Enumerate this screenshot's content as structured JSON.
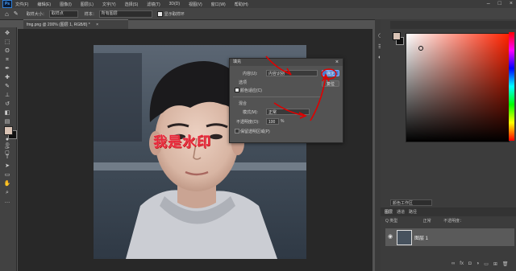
{
  "menu": [
    "文件(F)",
    "编辑(E)",
    "图像(I)",
    "图层(L)",
    "文字(Y)",
    "选择(S)",
    "滤镜(T)",
    "3D(D)",
    "视图(V)",
    "窗口(W)",
    "帮助(H)"
  ],
  "app_logo": "Ps",
  "options": {
    "sample_size_label": "取样大小：",
    "sample_size_value": "取样点",
    "sample_label": "样本：",
    "sample_value": "所有图层",
    "show_ring_label": "显示取样环"
  },
  "document": {
    "tab_title": "fmg.png @ 200% (图层 1, RGB/8) *",
    "close": "×"
  },
  "watermark_text": "我是水印",
  "fill_dialog": {
    "title": "填充",
    "content_label": "内容(U):",
    "content_value": "内容识别",
    "options_label": "选项",
    "color_adapt_label": "颜色适应(C)",
    "blend_label": "混合",
    "mode_label": "模式(M):",
    "mode_value": "正常",
    "opacity_label": "不透明度(O):",
    "opacity_value": "100",
    "opacity_unit": "%",
    "preserve_label": "保留透明区域(P)",
    "ok_label": "确定",
    "cancel_label": "复位"
  },
  "layers_panel": {
    "tabs": [
      "图层",
      "通道",
      "路径"
    ],
    "kind_label": "Q 类型",
    "blend_mode": "正常",
    "opacity_label": "不透明度：",
    "lock_label": "锁定：",
    "fill_label": "填充：",
    "layer_name": "图层 1"
  },
  "panel_dropdown": "颜色工作区",
  "colors": {
    "accent_red": "#e00000",
    "swatch_fg": "#d9c3b5",
    "swatch_bg": "#111111"
  }
}
